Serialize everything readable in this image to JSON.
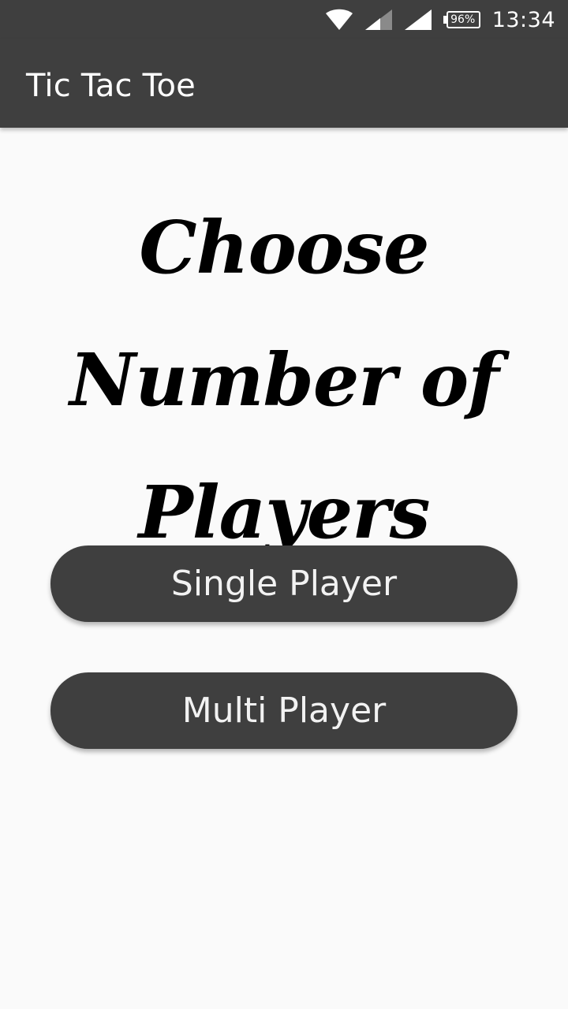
{
  "status_bar": {
    "time": "13:34",
    "battery_percent": "96%",
    "icons": [
      "wifi-icon",
      "cell-signal-icon",
      "cell-signal-icon",
      "battery-icon"
    ]
  },
  "app_bar": {
    "title": "Tic Tac Toe"
  },
  "main": {
    "heading": "Choose Number of Players",
    "buttons": {
      "single_player": "Single Player",
      "multi_player": "Multi Player"
    }
  },
  "colors": {
    "app_bar_background": "#3F3F3F",
    "page_background": "#FAFAFA",
    "button_background": "#3F3F3F",
    "button_text": "#F2F2F2",
    "heading_text": "#000000"
  }
}
